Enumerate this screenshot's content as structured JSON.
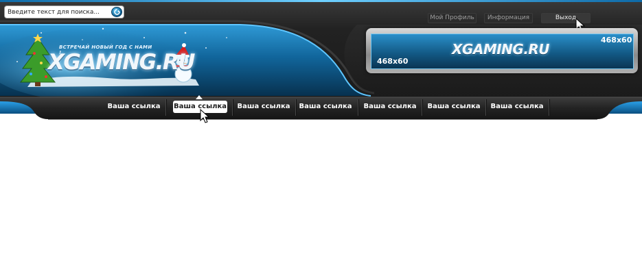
{
  "search": {
    "placeholder": "Введите текст для поиска...",
    "button_icon": "search-arrow-icon"
  },
  "top_links": [
    {
      "label": "Мой Профиль"
    },
    {
      "label": "Информация"
    },
    {
      "label": "Выход"
    }
  ],
  "logo": {
    "tagline": "ВСТРЕЧАЙ НОВЫЙ ГОД С НАМИ !",
    "text": "XGAMING.RU"
  },
  "banner": {
    "size_left": "468x60",
    "size_right": "468x60",
    "logo_text": "XGAMING.RU"
  },
  "nav": {
    "items": [
      {
        "label": "Ваша ссылка"
      },
      {
        "label": "Ваша ссылка",
        "active": true
      },
      {
        "label": "Ваша ссылка"
      },
      {
        "label": "Ваша ссылка"
      },
      {
        "label": "Ваша ссылка"
      },
      {
        "label": "Ваша ссылка"
      },
      {
        "label": "Ваша ссылка"
      }
    ]
  },
  "colors": {
    "accent_blue": "#1a7fc0",
    "header_dark": "#222222",
    "nav_active_bg": "#ffffff"
  }
}
